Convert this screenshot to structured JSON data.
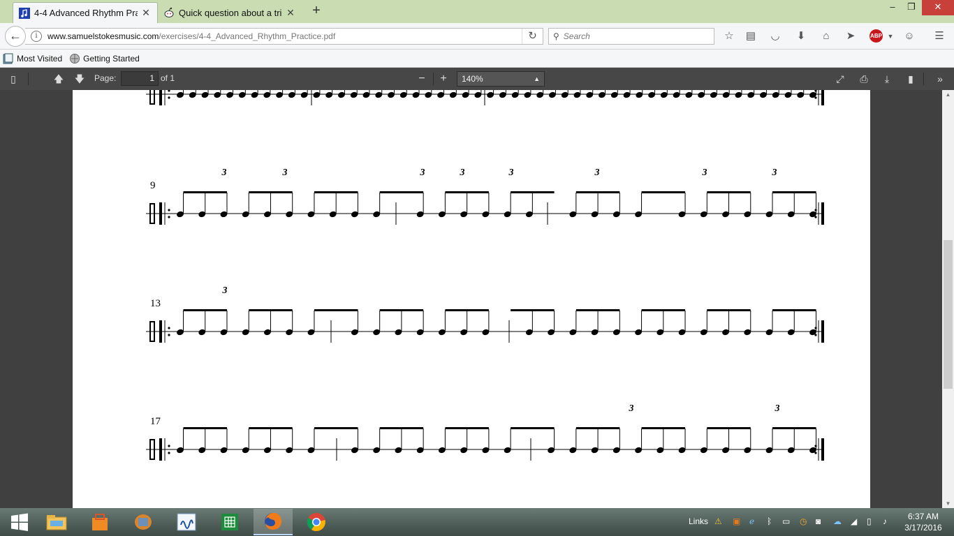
{
  "tabs": [
    {
      "title": "4-4 Advanced Rhythm Pra...",
      "icon": "music-note-icon",
      "active": true
    },
    {
      "title": "Quick question about a tri...",
      "icon": "reddit-icon",
      "active": false
    }
  ],
  "window_controls": {
    "minimize": "–",
    "restore": "❐",
    "close": "✕"
  },
  "nav": {
    "url_host": "www.samuelstokesmusic.com",
    "url_path": "/exercises/4-4_Advanced_Rhythm_Practice.pdf",
    "search_placeholder": "Search"
  },
  "bookmarks": [
    {
      "label": "Most Visited",
      "icon": "most-visited-icon"
    },
    {
      "label": "Getting Started",
      "icon": "getting-started-icon"
    }
  ],
  "pdf_toolbar": {
    "page_label": "Page:",
    "page_value": "1",
    "page_of": "of 1",
    "zoom_value": "140%"
  },
  "score": {
    "systems": [
      {
        "measure_number": "",
        "tuplets": []
      },
      {
        "measure_number": "9",
        "tuplets": [
          "3",
          "3",
          "3",
          "3",
          "3",
          "3",
          "3",
          "3"
        ]
      },
      {
        "measure_number": "13",
        "tuplets": [
          "3"
        ]
      },
      {
        "measure_number": "17",
        "tuplets": [
          "3",
          "3"
        ]
      }
    ]
  },
  "taskbar": {
    "apps": [
      "task-view-icon",
      "file-explorer-icon",
      "store-app-icon",
      "media-app-icon",
      "audio-app-icon",
      "excel-icon",
      "firefox-icon",
      "chrome-icon"
    ],
    "links_label": "Links",
    "time": "6:37 AM",
    "date": "3/17/2016"
  }
}
